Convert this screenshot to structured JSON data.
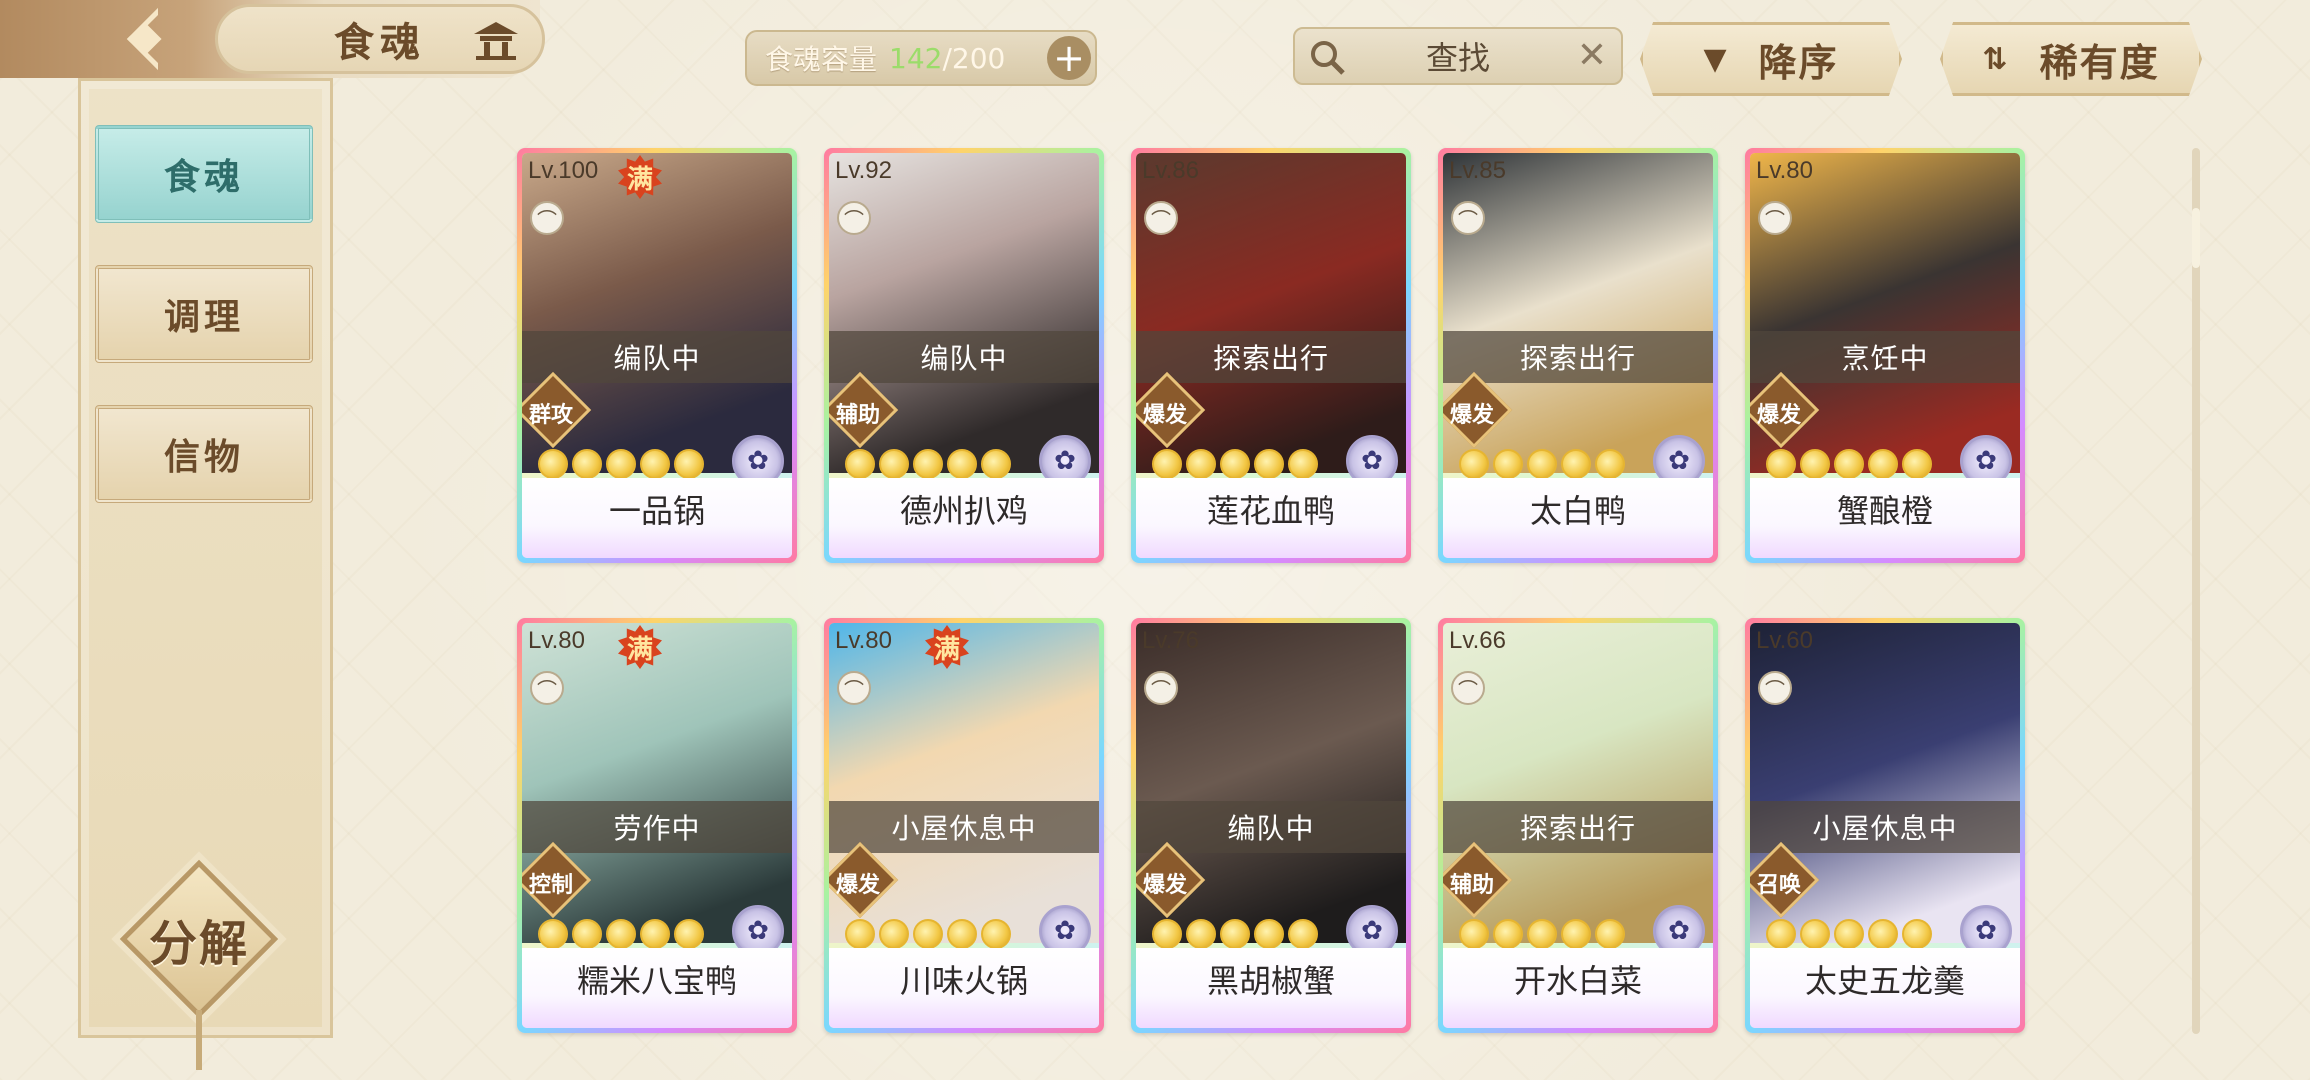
{
  "header": {
    "title": "食魂",
    "capacity_label": "食魂容量",
    "capacity_current": "142",
    "capacity_sep": "/",
    "capacity_max": "200",
    "capacity_plus": "+",
    "search_placeholder": "查找",
    "search_clear": "✕",
    "sort_order_label": "降序",
    "sort_field_label": "稀有度",
    "sort_order_icon": "▼",
    "sort_field_icon": "⇅"
  },
  "sidebar": {
    "items": [
      {
        "label": "食魂",
        "active": true
      },
      {
        "label": "调理",
        "active": false
      },
      {
        "label": "信物",
        "active": false
      }
    ],
    "decompose_label": "分解"
  },
  "colors": {
    "status_overlay": "#50463c",
    "role_tag": "#8a5a2c",
    "max_badge": "#d9431e",
    "active_tab": "#96d3cf",
    "capacity_current": "#9bdc6a"
  },
  "cards": [
    {
      "level": "Lv.100",
      "max": "满",
      "status": "编队中",
      "role": "群攻",
      "stars": 5,
      "name": "一品锅"
    },
    {
      "level": "Lv.92",
      "max": "",
      "status": "编队中",
      "role": "辅助",
      "stars": 5,
      "name": "德州扒鸡"
    },
    {
      "level": "Lv.86",
      "max": "",
      "status": "探索出行",
      "role": "爆发",
      "stars": 5,
      "name": "莲花血鸭"
    },
    {
      "level": "Lv.85",
      "max": "",
      "status": "探索出行",
      "role": "爆发",
      "stars": 5,
      "name": "太白鸭"
    },
    {
      "level": "Lv.80",
      "max": "",
      "status": "烹饪中",
      "role": "爆发",
      "stars": 5,
      "name": "蟹酿橙"
    },
    {
      "level": "Lv.80",
      "max": "满",
      "status": "劳作中",
      "role": "控制",
      "stars": 5,
      "name": "糯米八宝鸭"
    },
    {
      "level": "Lv.80",
      "max": "满",
      "status": "小屋休息中",
      "role": "爆发",
      "stars": 5,
      "name": "川味火锅"
    },
    {
      "level": "Lv.76",
      "max": "",
      "status": "编队中",
      "role": "爆发",
      "stars": 5,
      "name": "黑胡椒蟹"
    },
    {
      "level": "Lv.66",
      "max": "",
      "status": "探索出行",
      "role": "辅助",
      "stars": 5,
      "name": "开水白菜"
    },
    {
      "level": "Lv.60",
      "max": "",
      "status": "小屋休息中",
      "role": "召唤",
      "stars": 5,
      "name": "太史五龙羹"
    }
  ],
  "icons": {
    "back": "back-arrow-icon",
    "temple": "temple-icon",
    "search": "search-icon",
    "element": "flower-element-icon",
    "mini": "leaf-icon"
  }
}
